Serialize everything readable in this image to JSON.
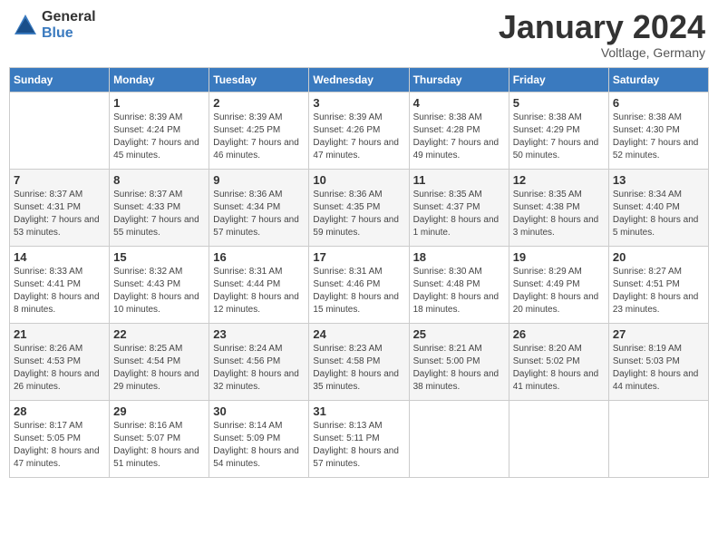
{
  "header": {
    "logo_general": "General",
    "logo_blue": "Blue",
    "month_title": "January 2024",
    "location": "Voltlage, Germany"
  },
  "days_of_week": [
    "Sunday",
    "Monday",
    "Tuesday",
    "Wednesday",
    "Thursday",
    "Friday",
    "Saturday"
  ],
  "weeks": [
    [
      {
        "day": "",
        "sunrise": "",
        "sunset": "",
        "daylight": ""
      },
      {
        "day": "1",
        "sunrise": "Sunrise: 8:39 AM",
        "sunset": "Sunset: 4:24 PM",
        "daylight": "Daylight: 7 hours and 45 minutes."
      },
      {
        "day": "2",
        "sunrise": "Sunrise: 8:39 AM",
        "sunset": "Sunset: 4:25 PM",
        "daylight": "Daylight: 7 hours and 46 minutes."
      },
      {
        "day": "3",
        "sunrise": "Sunrise: 8:39 AM",
        "sunset": "Sunset: 4:26 PM",
        "daylight": "Daylight: 7 hours and 47 minutes."
      },
      {
        "day": "4",
        "sunrise": "Sunrise: 8:38 AM",
        "sunset": "Sunset: 4:28 PM",
        "daylight": "Daylight: 7 hours and 49 minutes."
      },
      {
        "day": "5",
        "sunrise": "Sunrise: 8:38 AM",
        "sunset": "Sunset: 4:29 PM",
        "daylight": "Daylight: 7 hours and 50 minutes."
      },
      {
        "day": "6",
        "sunrise": "Sunrise: 8:38 AM",
        "sunset": "Sunset: 4:30 PM",
        "daylight": "Daylight: 7 hours and 52 minutes."
      }
    ],
    [
      {
        "day": "7",
        "sunrise": "Sunrise: 8:37 AM",
        "sunset": "Sunset: 4:31 PM",
        "daylight": "Daylight: 7 hours and 53 minutes."
      },
      {
        "day": "8",
        "sunrise": "Sunrise: 8:37 AM",
        "sunset": "Sunset: 4:33 PM",
        "daylight": "Daylight: 7 hours and 55 minutes."
      },
      {
        "day": "9",
        "sunrise": "Sunrise: 8:36 AM",
        "sunset": "Sunset: 4:34 PM",
        "daylight": "Daylight: 7 hours and 57 minutes."
      },
      {
        "day": "10",
        "sunrise": "Sunrise: 8:36 AM",
        "sunset": "Sunset: 4:35 PM",
        "daylight": "Daylight: 7 hours and 59 minutes."
      },
      {
        "day": "11",
        "sunrise": "Sunrise: 8:35 AM",
        "sunset": "Sunset: 4:37 PM",
        "daylight": "Daylight: 8 hours and 1 minute."
      },
      {
        "day": "12",
        "sunrise": "Sunrise: 8:35 AM",
        "sunset": "Sunset: 4:38 PM",
        "daylight": "Daylight: 8 hours and 3 minutes."
      },
      {
        "day": "13",
        "sunrise": "Sunrise: 8:34 AM",
        "sunset": "Sunset: 4:40 PM",
        "daylight": "Daylight: 8 hours and 5 minutes."
      }
    ],
    [
      {
        "day": "14",
        "sunrise": "Sunrise: 8:33 AM",
        "sunset": "Sunset: 4:41 PM",
        "daylight": "Daylight: 8 hours and 8 minutes."
      },
      {
        "day": "15",
        "sunrise": "Sunrise: 8:32 AM",
        "sunset": "Sunset: 4:43 PM",
        "daylight": "Daylight: 8 hours and 10 minutes."
      },
      {
        "day": "16",
        "sunrise": "Sunrise: 8:31 AM",
        "sunset": "Sunset: 4:44 PM",
        "daylight": "Daylight: 8 hours and 12 minutes."
      },
      {
        "day": "17",
        "sunrise": "Sunrise: 8:31 AM",
        "sunset": "Sunset: 4:46 PM",
        "daylight": "Daylight: 8 hours and 15 minutes."
      },
      {
        "day": "18",
        "sunrise": "Sunrise: 8:30 AM",
        "sunset": "Sunset: 4:48 PM",
        "daylight": "Daylight: 8 hours and 18 minutes."
      },
      {
        "day": "19",
        "sunrise": "Sunrise: 8:29 AM",
        "sunset": "Sunset: 4:49 PM",
        "daylight": "Daylight: 8 hours and 20 minutes."
      },
      {
        "day": "20",
        "sunrise": "Sunrise: 8:27 AM",
        "sunset": "Sunset: 4:51 PM",
        "daylight": "Daylight: 8 hours and 23 minutes."
      }
    ],
    [
      {
        "day": "21",
        "sunrise": "Sunrise: 8:26 AM",
        "sunset": "Sunset: 4:53 PM",
        "daylight": "Daylight: 8 hours and 26 minutes."
      },
      {
        "day": "22",
        "sunrise": "Sunrise: 8:25 AM",
        "sunset": "Sunset: 4:54 PM",
        "daylight": "Daylight: 8 hours and 29 minutes."
      },
      {
        "day": "23",
        "sunrise": "Sunrise: 8:24 AM",
        "sunset": "Sunset: 4:56 PM",
        "daylight": "Daylight: 8 hours and 32 minutes."
      },
      {
        "day": "24",
        "sunrise": "Sunrise: 8:23 AM",
        "sunset": "Sunset: 4:58 PM",
        "daylight": "Daylight: 8 hours and 35 minutes."
      },
      {
        "day": "25",
        "sunrise": "Sunrise: 8:21 AM",
        "sunset": "Sunset: 5:00 PM",
        "daylight": "Daylight: 8 hours and 38 minutes."
      },
      {
        "day": "26",
        "sunrise": "Sunrise: 8:20 AM",
        "sunset": "Sunset: 5:02 PM",
        "daylight": "Daylight: 8 hours and 41 minutes."
      },
      {
        "day": "27",
        "sunrise": "Sunrise: 8:19 AM",
        "sunset": "Sunset: 5:03 PM",
        "daylight": "Daylight: 8 hours and 44 minutes."
      }
    ],
    [
      {
        "day": "28",
        "sunrise": "Sunrise: 8:17 AM",
        "sunset": "Sunset: 5:05 PM",
        "daylight": "Daylight: 8 hours and 47 minutes."
      },
      {
        "day": "29",
        "sunrise": "Sunrise: 8:16 AM",
        "sunset": "Sunset: 5:07 PM",
        "daylight": "Daylight: 8 hours and 51 minutes."
      },
      {
        "day": "30",
        "sunrise": "Sunrise: 8:14 AM",
        "sunset": "Sunset: 5:09 PM",
        "daylight": "Daylight: 8 hours and 54 minutes."
      },
      {
        "day": "31",
        "sunrise": "Sunrise: 8:13 AM",
        "sunset": "Sunset: 5:11 PM",
        "daylight": "Daylight: 8 hours and 57 minutes."
      },
      {
        "day": "",
        "sunrise": "",
        "sunset": "",
        "daylight": ""
      },
      {
        "day": "",
        "sunrise": "",
        "sunset": "",
        "daylight": ""
      },
      {
        "day": "",
        "sunrise": "",
        "sunset": "",
        "daylight": ""
      }
    ]
  ]
}
